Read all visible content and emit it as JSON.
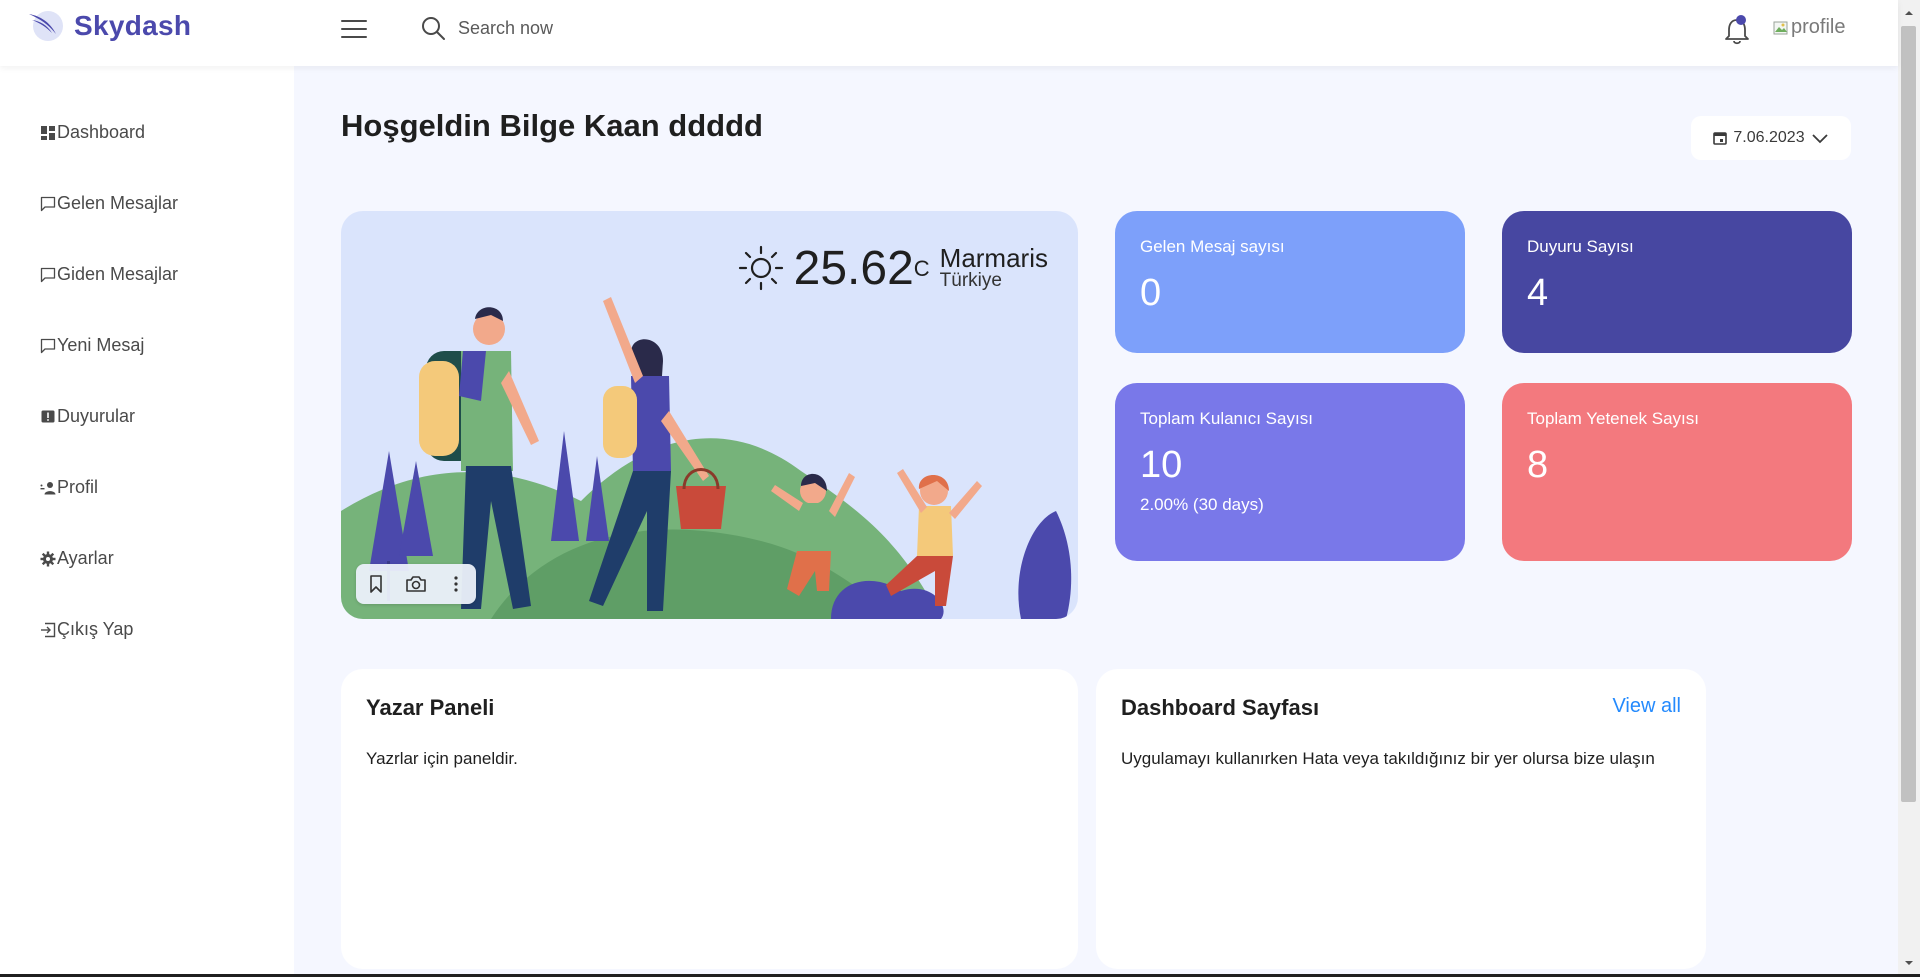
{
  "brand": {
    "name": "Skydash",
    "color": "#4b49ac"
  },
  "header": {
    "search_placeholder": "Search now",
    "profile_alt": "profile",
    "icons": [
      "menu-icon",
      "search-icon",
      "bell-icon"
    ]
  },
  "sidebar": {
    "items": [
      {
        "label": "Dashboard",
        "icon": "dashboard-icon"
      },
      {
        "label": "Gelen Mesajlar",
        "icon": "message-icon"
      },
      {
        "label": "Giden Mesajlar",
        "icon": "message-icon"
      },
      {
        "label": "Yeni Mesaj",
        "icon": "message-icon"
      },
      {
        "label": "Duyurular",
        "icon": "alert-icon"
      },
      {
        "label": "Profil",
        "icon": "user-icon"
      },
      {
        "label": "Ayarlar",
        "icon": "gear-icon"
      },
      {
        "label": "Çıkış Yap",
        "icon": "logout-icon"
      }
    ]
  },
  "main": {
    "welcome": "Hoşgeldin Bilge Kaan ddddd",
    "date": "7.06.2023",
    "weather": {
      "temperature": "25.62",
      "unit": "C",
      "city": "Marmaris",
      "country": "Türkiye"
    },
    "stats": [
      {
        "label": "Gelen Mesaj sayısı",
        "value": "0",
        "color": "#7da0fa"
      },
      {
        "label": "Duyuru Sayısı",
        "value": "4",
        "color": "#4747a1"
      },
      {
        "label": "Toplam Kulanıcı Sayısı",
        "value": "10",
        "sub": "2.00% (30 days)",
        "color": "#7978e9"
      },
      {
        "label": "Toplam Yetenek Sayısı",
        "value": "8",
        "color": "#f3797e"
      }
    ],
    "cards": [
      {
        "title": "Yazar Paneli",
        "description": "Yazrlar için paneldir."
      },
      {
        "title": "Dashboard Sayfası",
        "description": "Uygulamayı kullanırken Hata veya takıldığınız bir yer olursa bize ulaşın",
        "link": "View all"
      }
    ]
  },
  "colors": {
    "background": "#f5f7ff",
    "hero_bg": "#dae4fc",
    "link": "#248afd"
  }
}
